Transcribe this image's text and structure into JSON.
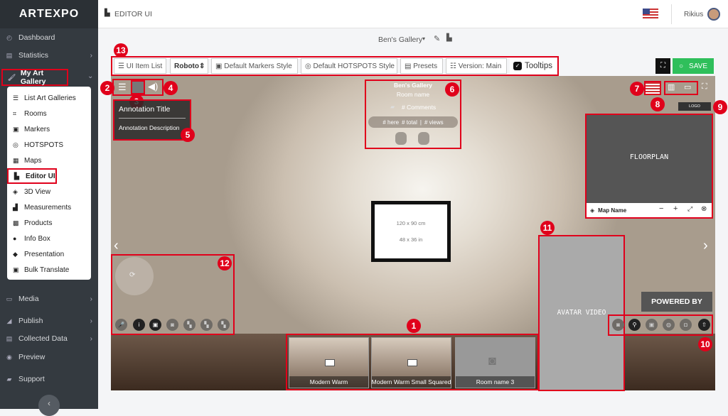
{
  "brand": "ARTEXPO",
  "sidebar": {
    "items": [
      {
        "label": "Dashboard",
        "icon": "dashboard-icon"
      },
      {
        "label": "Statistics",
        "icon": "chart-icon"
      },
      {
        "label": "My Art Gallery",
        "icon": "gallery-icon"
      },
      {
        "label": "Media",
        "icon": "media-icon"
      },
      {
        "label": "Publish",
        "icon": "publish-icon"
      },
      {
        "label": "Collected Data",
        "icon": "data-icon"
      },
      {
        "label": "Preview",
        "icon": "eye-icon"
      },
      {
        "label": "Support",
        "icon": "support-icon"
      }
    ],
    "submenu": [
      {
        "label": "List Art Galleries"
      },
      {
        "label": "Rooms"
      },
      {
        "label": "Markers"
      },
      {
        "label": "HOTSPOTS"
      },
      {
        "label": "Maps"
      },
      {
        "label": "Editor UI"
      },
      {
        "label": "3D View"
      },
      {
        "label": "Measurements"
      },
      {
        "label": "Products"
      },
      {
        "label": "Info Box"
      },
      {
        "label": "Presentation"
      },
      {
        "label": "Bulk Translate"
      }
    ]
  },
  "header": {
    "title": "EDITOR UI",
    "user": "Rikius"
  },
  "gallery_title": "Ben's Gallery",
  "toolbar": {
    "items": [
      "UI Item List",
      "Roboto",
      "Default Markers Style",
      "Default HOTSPOTS Style",
      "Presets",
      "Version: Main",
      "Tooltips"
    ],
    "save": "SAVE"
  },
  "viewer": {
    "annotation_title": "Annotation Title",
    "annotation_desc": "Annotation Description",
    "info_gallery": "Ben's Gallery",
    "info_room": "Room name",
    "info_comments": "# Comments",
    "info_here": "# here",
    "info_total": "# total",
    "info_sep": "|",
    "info_views": "# views",
    "logo": "LOGO",
    "floorplan": "FLOORPLAN",
    "map_name": "Map Name",
    "frame_cm": "120 x 90 cm",
    "frame_in": "48 x 36 in",
    "avatar": "AVATAR VIDEO",
    "powered": "POWERED BY",
    "rooms": [
      "Modern Warm",
      "Modern Warm Small Squared",
      "Room name 3"
    ]
  },
  "badges": [
    "1",
    "2",
    "3",
    "4",
    "5",
    "6",
    "7",
    "8",
    "9",
    "10",
    "11",
    "12",
    "13"
  ],
  "colors": {
    "sidebar": "#343a40",
    "highlight": "#e0001b",
    "save": "#2fbf5b"
  }
}
